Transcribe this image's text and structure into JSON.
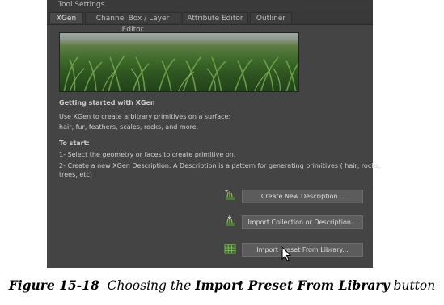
{
  "panel": {
    "title": "Tool Settings",
    "tabs": [
      {
        "label": "XGen",
        "active": true
      },
      {
        "label": "Channel Box / Layer Editor",
        "active": false
      },
      {
        "label": "Attribute Editor",
        "active": false
      },
      {
        "label": "Outliner",
        "active": false
      }
    ],
    "heading": "Getting started with XGen",
    "intro_line1": "Use XGen to create arbitrary primitives on a surface:",
    "intro_line2": "hair, fur, feathers, scales, rocks, and more.",
    "to_start": "To start:",
    "step1": "1- Select the geometry or faces to create primitive on.",
    "step2_line1": "2- Create a new XGen Description. A Description is a pattern for generating primitives ( hair, rocks,",
    "step2_line2": "trees, etc)",
    "buttons": {
      "create_new": "Create New Description...",
      "import_collection": "Import Collection or Description...",
      "import_preset": "Import Preset From Library..."
    }
  },
  "caption": {
    "figure_label": "Figure 15-18",
    "text_before": "Choosing the",
    "text_bold": "Import Preset From Library",
    "text_after": "button"
  },
  "colors": {
    "panel_bg": "#444444",
    "button_bg": "#5c5c5c",
    "text": "#cfcfcf"
  }
}
